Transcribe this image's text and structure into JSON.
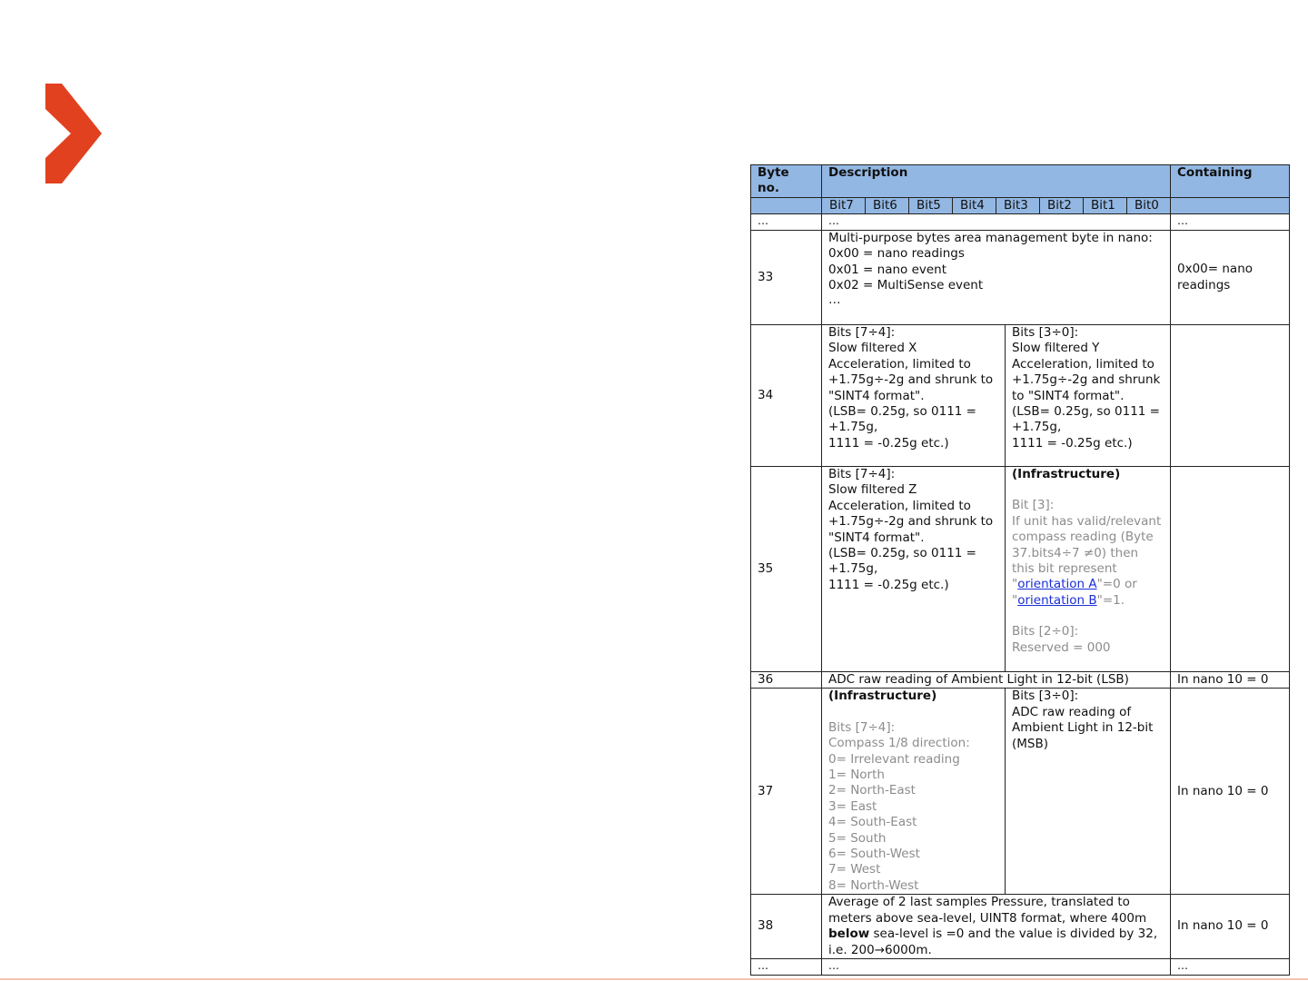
{
  "table": {
    "header": {
      "byte": "Byte no.",
      "description": "Description",
      "containing": "Containing"
    },
    "bits": [
      "Bit7",
      "Bit6",
      "Bit5",
      "Bit4",
      "Bit3",
      "Bit2",
      "Bit1",
      "Bit0"
    ],
    "ellipsis": "…",
    "rows": {
      "r33": {
        "byte": "33",
        "desc": [
          "Multi-purpose bytes area management byte in nano:",
          "0x00 = nano readings",
          "0x01 = nano event",
          "0x02 = MultiSense event",
          "…"
        ],
        "containing": "0x00= nano readings"
      },
      "r34": {
        "byte": "34",
        "left": [
          "Bits [7÷4]:",
          "Slow filtered X Acceleration, limited to +1.75g÷-2g and shrunk to \"SINT4 format\".",
          "(LSB= 0.25g, so 0111 = +1.75g,",
          "1111 = -0.25g etc.)"
        ],
        "right": [
          "Bits [3÷0]:",
          "Slow filtered Y Acceleration, limited to +1.75g÷-2g and shrunk to \"SINT4 format\".",
          "(LSB= 0.25g, so 0111 = +1.75g,",
          "1111 = -0.25g etc.)"
        ]
      },
      "r35": {
        "byte": "35",
        "left": [
          "Bits [7÷4]:",
          "Slow filtered Z Acceleration, limited to +1.75g÷-2g and shrunk to \"SINT4 format\".",
          "(LSB= 0.25g, so 0111 = +1.75g,",
          "1111 = -0.25g etc.)"
        ],
        "right_title": "(Infrastructure)",
        "right_bit": "Bit [3]:",
        "right_text": "If unit has valid/relevant compass reading (Byte 37.bits4÷7 ≠0) then this bit represent",
        "link_a": "orientation A",
        "link_a_suffix": "\"=0 or",
        "link_b": "orientation B",
        "link_b_suffix": "\"=1.",
        "right_bits2": "Bits [2÷0]:",
        "right_reserved": "Reserved = 000"
      },
      "r36": {
        "byte": "36",
        "desc": "ADC raw reading of Ambient Light in 12-bit (LSB)",
        "containing": "In nano 10 = 0"
      },
      "r37": {
        "byte": "37",
        "left_title": "(Infrastructure)",
        "left_lines": [
          "Bits [7÷4]:",
          "Compass 1/8 direction:",
          "0= Irrelevant reading",
          "1= North",
          "2= North-East",
          "3= East",
          "4= South-East",
          "5= South",
          "6= South-West",
          "7= West",
          "8= North-West"
        ],
        "right": [
          "Bits [3÷0]:",
          "ADC raw reading of Ambient Light in 12-bit (MSB)"
        ],
        "containing": "In nano 10 = 0"
      },
      "r38": {
        "byte": "38",
        "desc_a": "Average of 2 last samples Pressure, translated to meters above sea-level, UINT8 format, where 400m",
        "desc_bold": "below",
        "desc_b": "sea-level is =0 and the value is divided by 32, i.e. 200→6000m.",
        "containing": "In nano 10 = 0"
      }
    }
  },
  "colors": {
    "header_bg": "#93b7e3",
    "logo": "#e2411f",
    "link": "#1b2fd6",
    "gray_text": "#8c8c8c"
  },
  "logo_icon": "chevron-right-icon"
}
